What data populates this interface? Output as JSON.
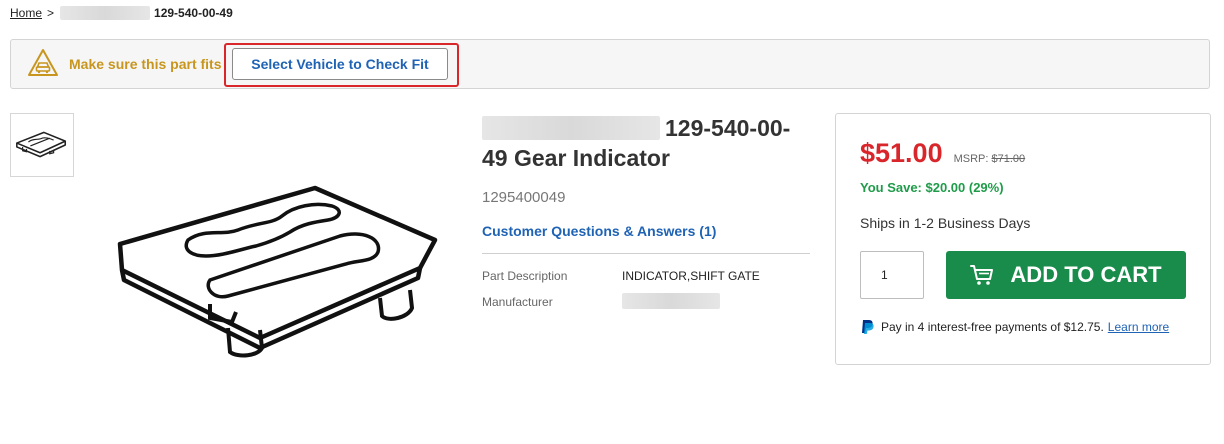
{
  "breadcrumb": {
    "home": "Home",
    "separator": ">",
    "current": "129-540-00-49"
  },
  "fit_bar": {
    "message": "Make sure this part fits",
    "button_label": "Select Vehicle to Check Fit",
    "icon": "vehicle-warning-icon",
    "accent_color": "#c8961e",
    "highlight_color": "#d9262b"
  },
  "product": {
    "title": "129-540-00-49 Gear Indicator",
    "part_number": "1295400049",
    "qa_link": "Customer Questions & Answers (1)",
    "specs": [
      {
        "label": "Part Description",
        "value": "INDICATOR,SHIFT GATE"
      },
      {
        "label": "Manufacturer",
        "value": ""
      }
    ],
    "image": "shift-gate-indicator-drawing"
  },
  "buy_box": {
    "price": "$51.00",
    "msrp_label": "MSRP:",
    "msrp_value": "$71.00",
    "savings": "You Save: $20.00 (29%)",
    "shipping": "Ships in 1-2 Business Days",
    "quantity": "1",
    "add_to_cart": "ADD TO CART",
    "paypal_text": "Pay in 4 interest-free payments of $12.75.",
    "paypal_link": "Learn more",
    "price_color": "#d9262b",
    "savings_color": "#1f9c4a",
    "cart_button_color": "#198c4b"
  }
}
